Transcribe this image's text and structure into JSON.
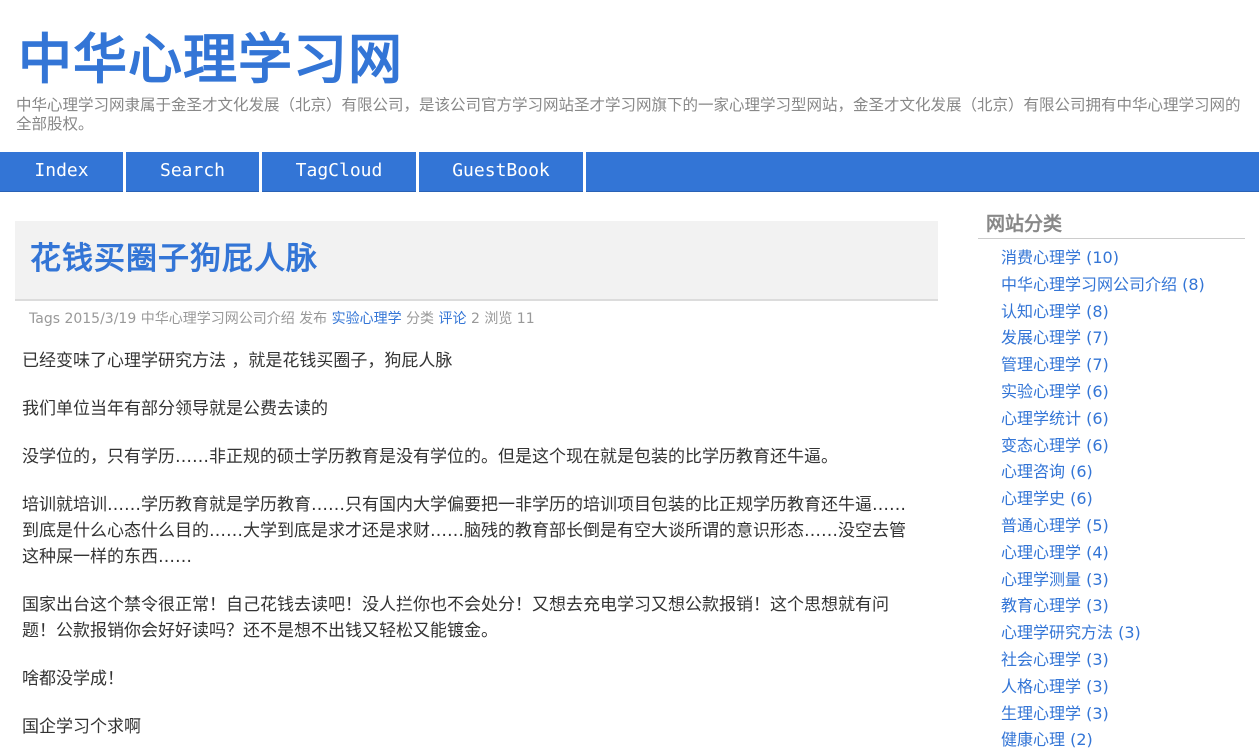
{
  "header": {
    "title": "中华心理学习网",
    "description": "中华心理学习网隶属于金圣才文化发展（北京）有限公司，是该公司官方学习网站圣才学习网旗下的一家心理学习型网站，金圣才文化发展（北京）有限公司拥有中华心理学习网的全部股权。"
  },
  "nav": {
    "items": [
      {
        "label": "Index"
      },
      {
        "label": "Search"
      },
      {
        "label": "TagCloud"
      },
      {
        "label": "GuestBook"
      }
    ]
  },
  "post": {
    "title": "花钱买圈子狗屁人脉",
    "meta": {
      "tags_label": "Tags",
      "date": "2015/3/19",
      "author": "中华心理学习网公司介绍",
      "publish_label": "发布",
      "category": "实验心理学",
      "category_label": "分类",
      "comment_label": "评论",
      "comment_count": "2",
      "view_label": "浏览",
      "view_count": "11"
    },
    "paragraphs": [
      "已经变味了心理学研究方法 ，就是花钱买圈子，狗屁人脉",
      "我们单位当年有部分领导就是公费去读的",
      "没学位的，只有学历……非正规的硕士学历教育是没有学位的。但是这个现在就是包装的比学历教育还牛逼。",
      "培训就培训……学历教育就是学历教育……只有国内大学偏要把一非学历的培训项目包装的比正规学历教育还牛逼……到底是什么心态什么目的……大学到底是求才还是求财……脑残的教育部长倒是有空大谈所谓的意识形态……没空去管这种屎一样的东西……",
      "国家出台这个禁令很正常！自己花钱去读吧！没人拦你也不会处分！又想去充电学习又想公款报销！这个思想就有问题！公款报销你会好好读吗？还不是想不出钱又轻松又能镀金。",
      "啥都没学成！",
      "国企学习个求啊"
    ]
  },
  "sidebar": {
    "title": "网站分类",
    "categories": [
      {
        "label": "消费心理学 (10)"
      },
      {
        "label": "中华心理学习网公司介绍 (8)"
      },
      {
        "label": "认知心理学 (8)"
      },
      {
        "label": "发展心理学 (7)"
      },
      {
        "label": "管理心理学 (7)"
      },
      {
        "label": "实验心理学 (6)"
      },
      {
        "label": "心理学统计 (6)"
      },
      {
        "label": "变态心理学 (6)"
      },
      {
        "label": "心理咨询 (6)"
      },
      {
        "label": "心理学史 (6)"
      },
      {
        "label": "普通心理学 (5)"
      },
      {
        "label": "心理心理学 (4)"
      },
      {
        "label": "心理学测量 (3)"
      },
      {
        "label": "教育心理学 (3)"
      },
      {
        "label": "心理学研究方法 (3)"
      },
      {
        "label": "社会心理学 (3)"
      },
      {
        "label": "人格心理学 (3)"
      },
      {
        "label": "生理心理学 (3)"
      },
      {
        "label": "健康心理 (2)"
      }
    ]
  },
  "colors": {
    "accent": "#3375d6",
    "muted_text": "#888888",
    "body_text": "#333333",
    "title_box_bg": "#f2f2f2"
  }
}
